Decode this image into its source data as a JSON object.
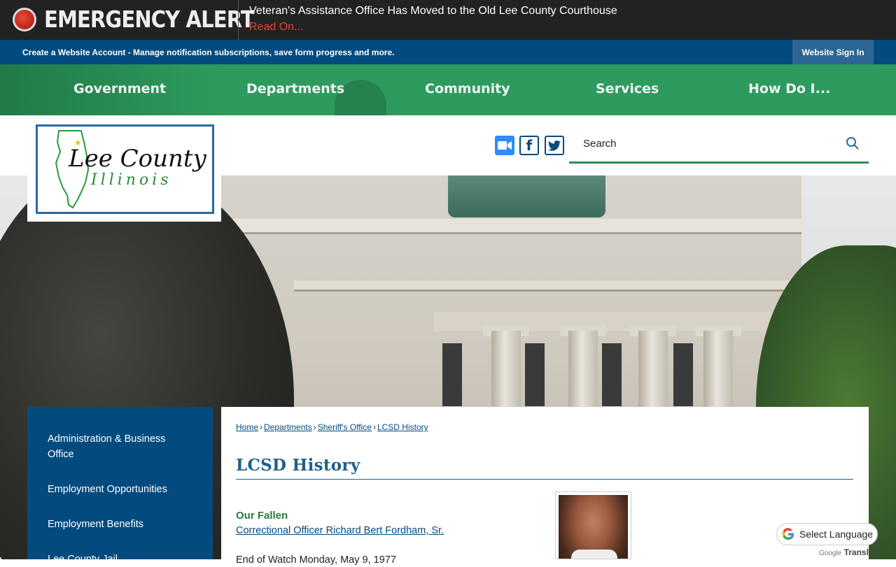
{
  "alert": {
    "title": "EMERGENCY ALERT",
    "message": "Veteran's Assistance Office Has Moved to the Old Lee County Courthouse",
    "link": "Read On..."
  },
  "account_bar": {
    "create_account": "Create a Website Account",
    "description": " - Manage notification subscriptions, save form progress and more.",
    "sign_in": "Website Sign In"
  },
  "nav": {
    "items": [
      "Government",
      "Departments",
      "Community",
      "Services",
      "How Do I..."
    ]
  },
  "logo": {
    "line1": "Lee County",
    "line2": "Illinois"
  },
  "social": {
    "icons": [
      "zoom-icon",
      "facebook-icon",
      "twitter-icon"
    ]
  },
  "search": {
    "placeholder": "Search"
  },
  "sidebar": {
    "items": [
      {
        "label": "Administration & Business Office"
      },
      {
        "label": "Employment Opportunities"
      },
      {
        "label": "Employment Benefits"
      },
      {
        "label": "Lee County Jail"
      }
    ]
  },
  "breadcrumb": {
    "items": [
      "Home",
      "Departments",
      "Sheriff's Office",
      "LCSD History"
    ],
    "separator": "›"
  },
  "page": {
    "title": "LCSD History",
    "fallen_heading": "Our Fallen",
    "fallen_link": "Correctional Officer Richard Bert Fordham, Sr.",
    "end_of_watch": "End of Watch Monday, May 9, 1977"
  },
  "translate": {
    "label": "Select Language",
    "powered_by_google": "Google",
    "powered_by_translate": "Translate"
  },
  "colors": {
    "alert_bg": "#222222",
    "alert_red": "#e0463a",
    "account_bar": "#034b7e",
    "nav_green": "#2e9b5e",
    "title_blue": "#1f5f8b",
    "heading_green": "#2a7a3b"
  }
}
